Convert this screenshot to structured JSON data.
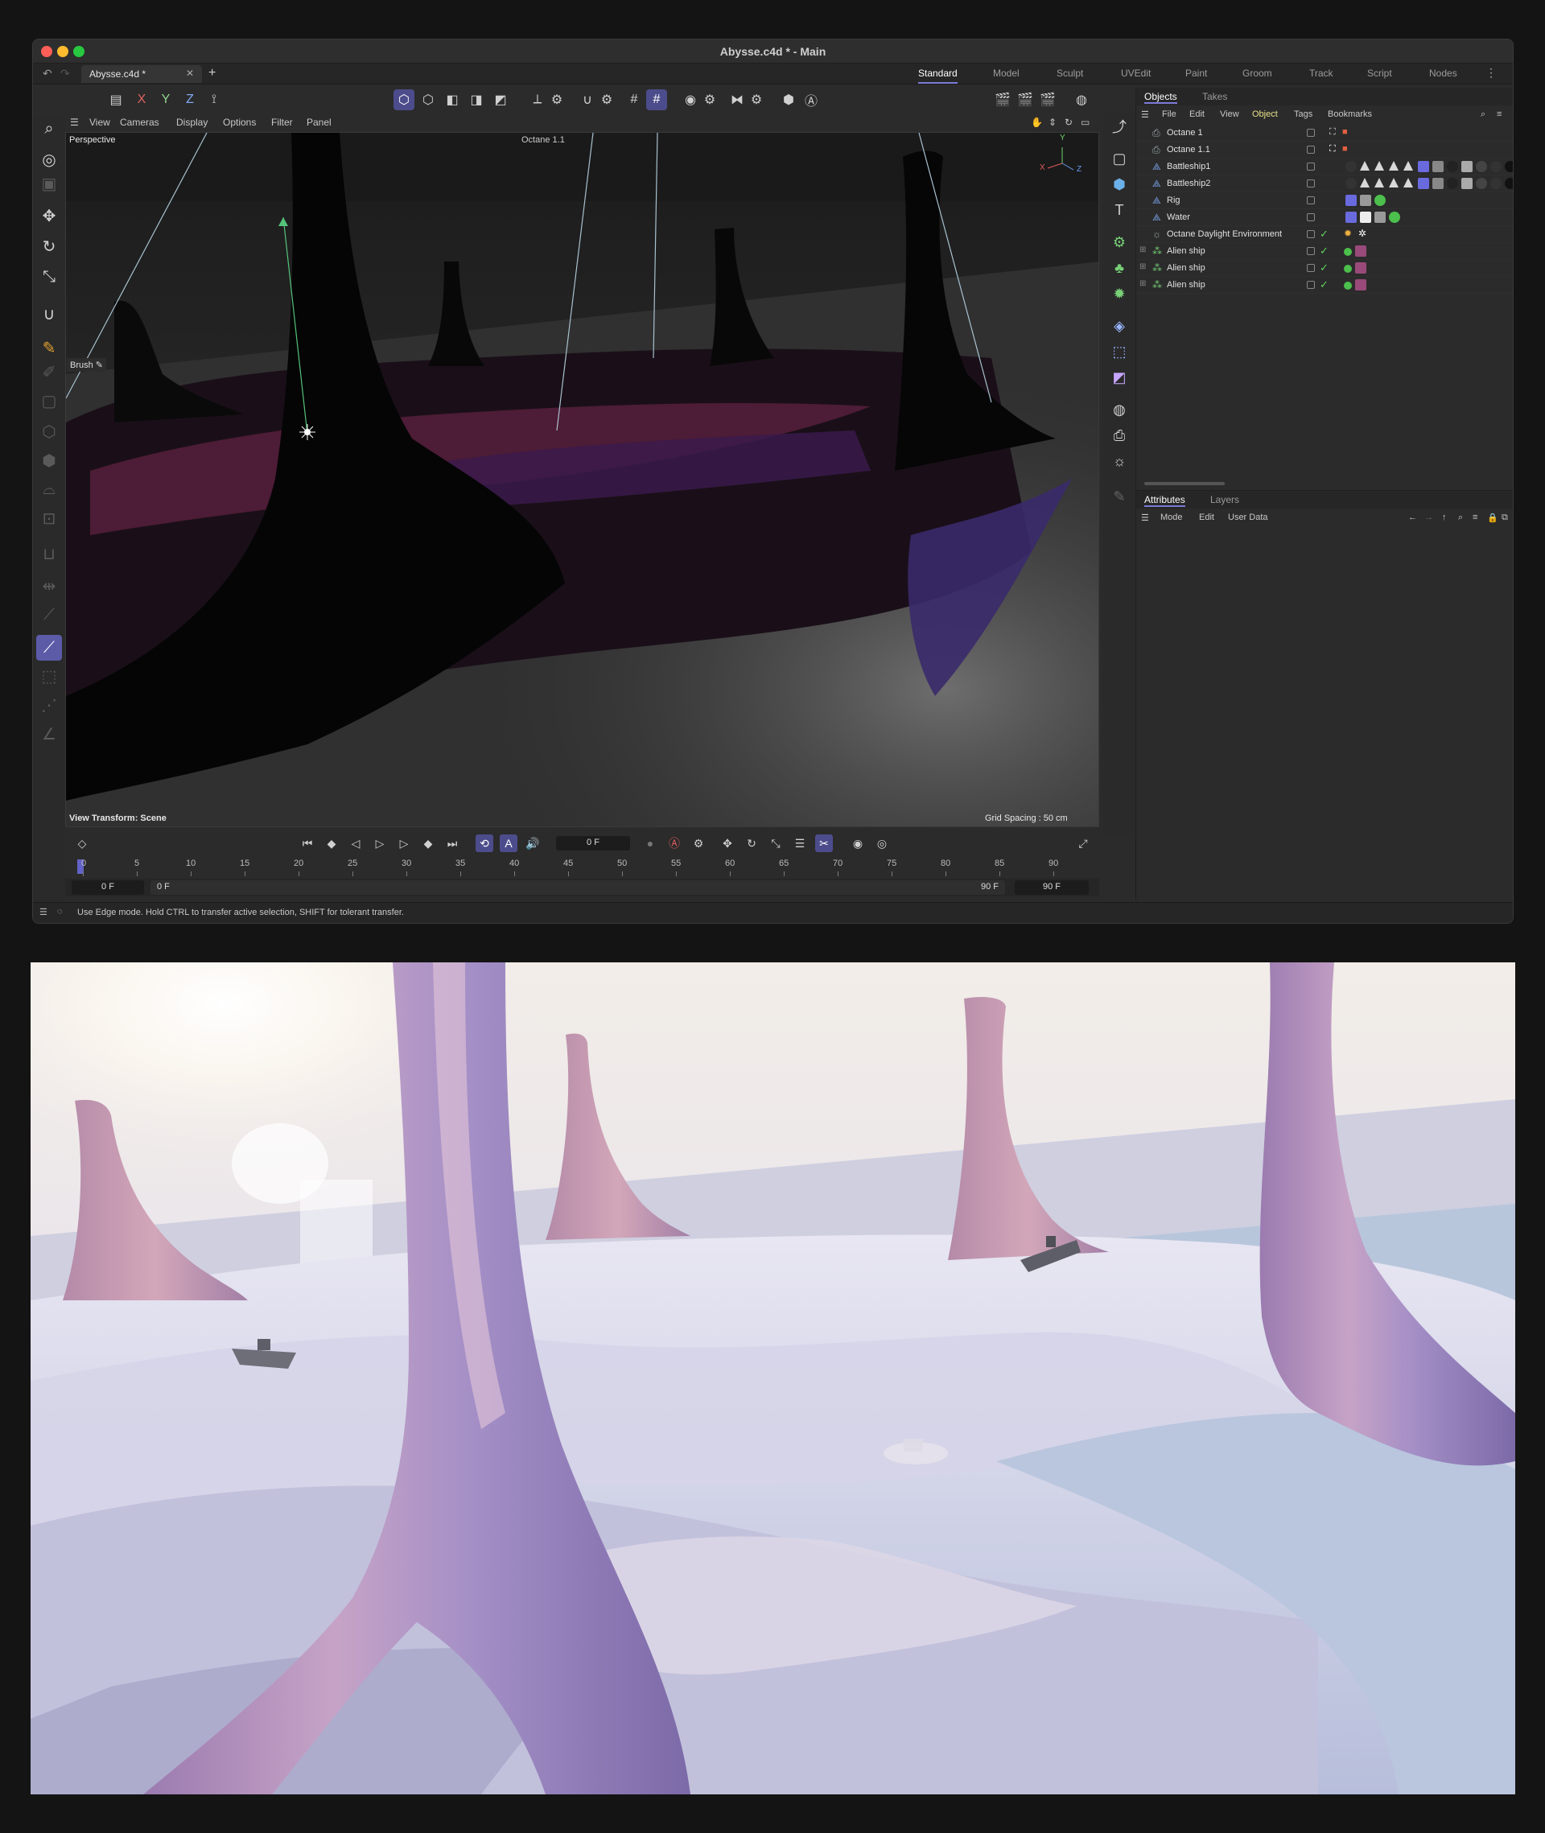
{
  "window": {
    "title": "Abysse.c4d * - Main",
    "doc_tab": "Abysse.c4d *",
    "traffic_colors": [
      "#ff5f57",
      "#febc2e",
      "#28c840"
    ]
  },
  "layout_tabs": [
    "Standard",
    "Model",
    "Sculpt",
    "UVEdit",
    "Paint",
    "Groom",
    "Track",
    "Script",
    "Nodes"
  ],
  "active_layout": "Standard",
  "top_toolbar": {
    "axis_x": "X",
    "axis_y": "Y",
    "axis_z": "Z"
  },
  "viewport": {
    "menu": [
      "View",
      "Cameras",
      "Display",
      "Options",
      "Filter",
      "Panel"
    ],
    "camera_label": "Perspective",
    "octane_label": "Octane 1.1",
    "brush_label": "Brush",
    "view_transform": "View Transform: Scene",
    "grid_spacing": "Grid Spacing : 50 cm",
    "axis_x": "X",
    "axis_y": "Y",
    "axis_z": "Z"
  },
  "timeline": {
    "current_frame": "0 F",
    "ticks": [
      "0",
      "5",
      "10",
      "15",
      "20",
      "25",
      "30",
      "35",
      "40",
      "45",
      "50",
      "55",
      "60",
      "65",
      "70",
      "75",
      "80",
      "85",
      "90"
    ],
    "start": "0 F",
    "preview_start": "0 F",
    "preview_end": "90 F",
    "end": "90 F"
  },
  "status": "Use Edge mode. Hold CTRL to transfer active selection, SHIFT for tolerant transfer.",
  "objects_panel": {
    "tabs": [
      "Objects",
      "Takes"
    ],
    "menu": [
      "File",
      "Edit",
      "View",
      "Object",
      "Tags",
      "Bookmarks"
    ],
    "active_menu": "Object",
    "items": [
      {
        "name": "Octane 1"
      },
      {
        "name": "Octane 1.1"
      },
      {
        "name": "Battleship1"
      },
      {
        "name": "Battleship2"
      },
      {
        "name": "Rig"
      },
      {
        "name": "Water"
      },
      {
        "name": "Octane Daylight Environment"
      },
      {
        "name": "Alien ship"
      },
      {
        "name": "Alien ship"
      },
      {
        "name": "Alien ship"
      }
    ]
  },
  "attributes_panel": {
    "tabs": [
      "Attributes",
      "Layers"
    ],
    "menu": [
      "Mode",
      "Edit",
      "User Data"
    ]
  },
  "colors": {
    "accent": "#5b5ba8",
    "check": "#5ed35e"
  }
}
